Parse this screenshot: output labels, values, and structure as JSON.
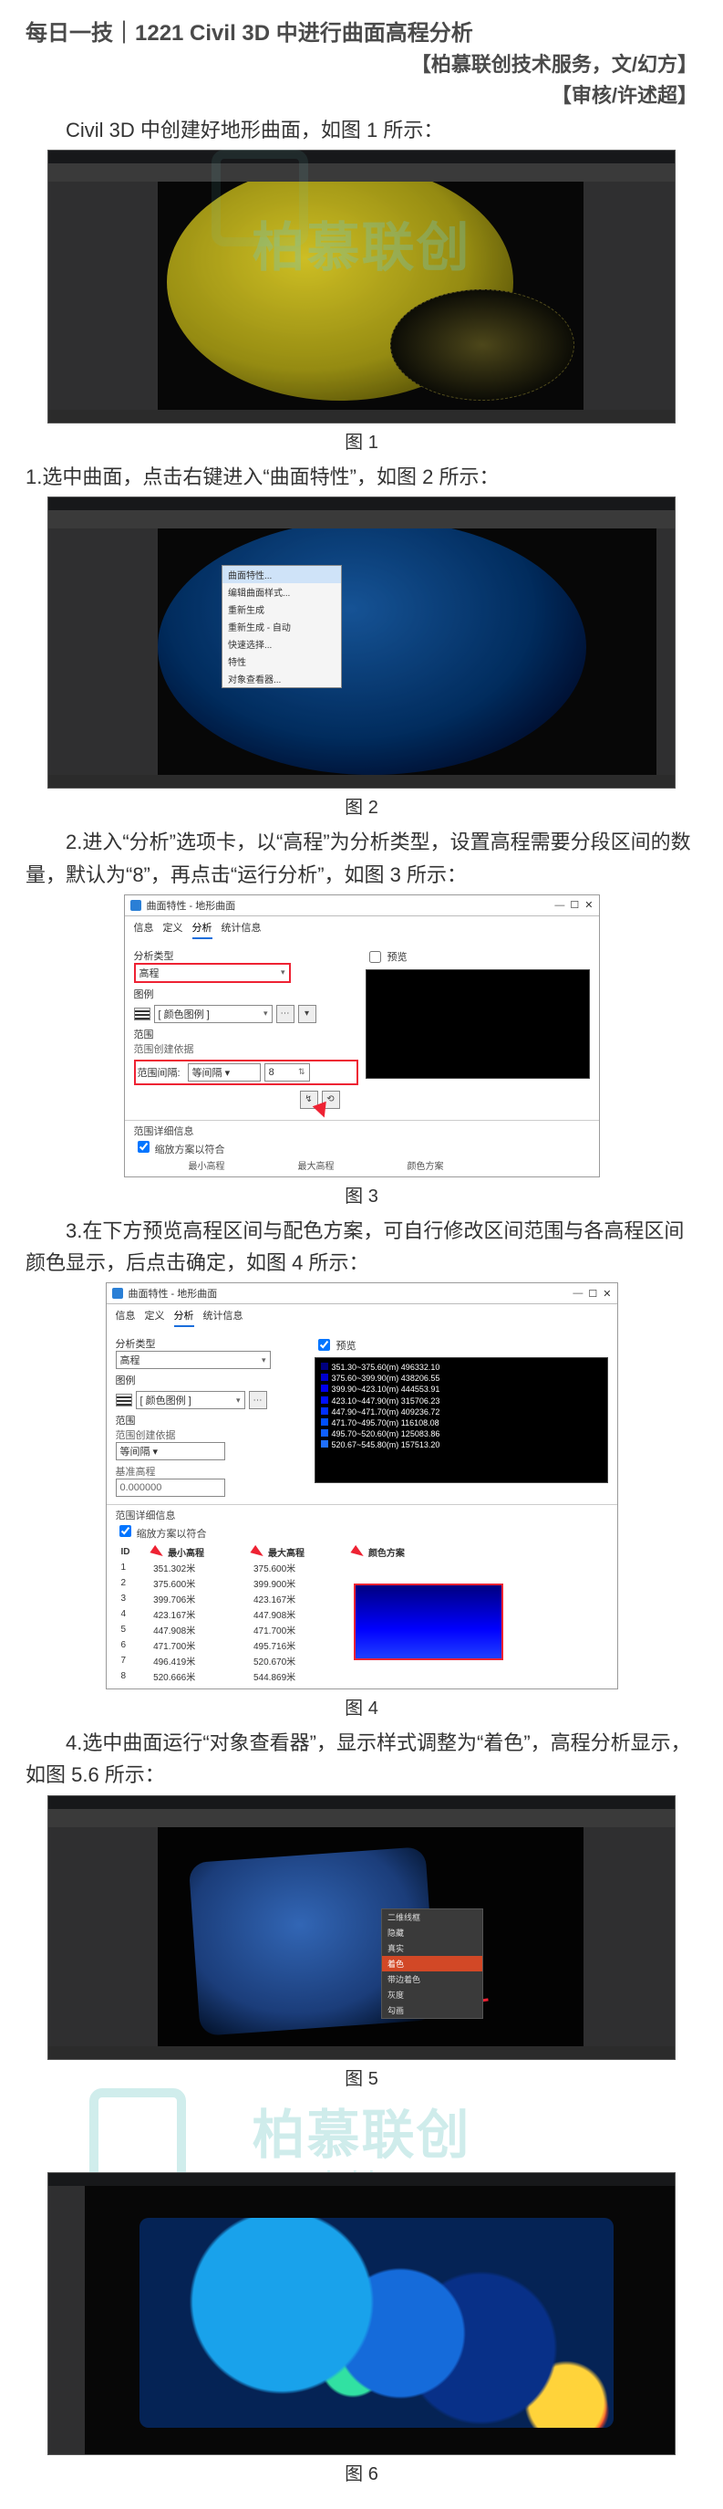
{
  "title": "每日一技｜1221 Civil 3D 中进行曲面高程分析",
  "byline1": "【柏慕联创技术服务，文/幻方】",
  "byline2": "【审核/许述超】",
  "p_intro": "Civil 3D 中创建好地形曲面，如图 1 所示：",
  "cap1": "图 1",
  "p1": "1.选中曲面，点击右键进入“曲面特性”，如图 2 所示：",
  "cap2": "图 2",
  "p2": "2.进入“分析”选项卡，以“高程”为分析类型，设置高程需要分段区间的数量，默认为“8”，再点击“运行分析”，如图 3 所示：",
  "cap3": "图 3",
  "p3": "3.在下方预览高程区间与配色方案，可自行修改区间范围与各高程区间颜色显示，后点击确定，如图 4 所示：",
  "cap4": "图 4",
  "p4": "4.选中曲面运行“对象查看器”，显示样式调整为“着色”，高程分析显示，如图 5.6 所示：",
  "cap5": "图 5",
  "cap6": "图 6",
  "ctxmenu2": {
    "items": [
      "曲面特性...",
      "编辑曲面样式...",
      "重新生成",
      "重新生成 - 自动",
      "快速选择...",
      "特性",
      "对象查看器..."
    ],
    "highlight_index": 0
  },
  "ctxmenu5": {
    "items": [
      "二维线框",
      "隐藏",
      "真实",
      "着色",
      "带边着色",
      "灰度",
      "勾画"
    ],
    "highlight_index": 3
  },
  "dlg": {
    "title": "曲面特性 - 地形曲面",
    "close": "✕",
    "min": "—",
    "sq": "☐",
    "tabs": [
      "信息",
      "定义",
      "分析",
      "统计信息"
    ],
    "active_tab": 2,
    "lbls": {
      "type": "分析类型",
      "type_val": "高程",
      "legend": "图例",
      "legend_combo": "[ 颜色图例 ]",
      "range": "范围",
      "createby": "范围创建依据",
      "createby_val": "等间隔 ▾",
      "rangecount": "范围间隔:",
      "rangecount_val": "8",
      "detail": "范围详细信息",
      "chk_fit": "缩放方案以符合",
      "num_small": "0.000000",
      "preview_chk": "预览"
    },
    "dlg3_preview": "",
    "dlg4_preview_lines": [
      "351.30~375.60(m)   496332.10",
      "375.60~399.90(m)   438206.55",
      "399.90~423.10(m)   444553.91",
      "423.10~447.90(m)   315706.23",
      "447.90~471.70(m)   409236.72",
      "471.70~495.70(m)   116108.08",
      "495.70~520.60(m)   125083.86",
      "520.67~545.80(m)   157513.20"
    ],
    "table_head": [
      "ID",
      "最小高程",
      "最大高程",
      "颜色方案"
    ],
    "table_rows": [
      [
        "1",
        "351.302米",
        "375.600米"
      ],
      [
        "2",
        "375.600米",
        "399.900米"
      ],
      [
        "3",
        "399.706米",
        "423.167米"
      ],
      [
        "4",
        "423.167米",
        "447.908米"
      ],
      [
        "5",
        "447.908米",
        "471.700米"
      ],
      [
        "6",
        "471.700米",
        "495.716米"
      ],
      [
        "7",
        "496.419米",
        "520.670米"
      ],
      [
        "8",
        "520.666米",
        "544.869米"
      ]
    ]
  },
  "watermark": {
    "text": "柏慕联创",
    "sub": "www.lcbim.com"
  }
}
